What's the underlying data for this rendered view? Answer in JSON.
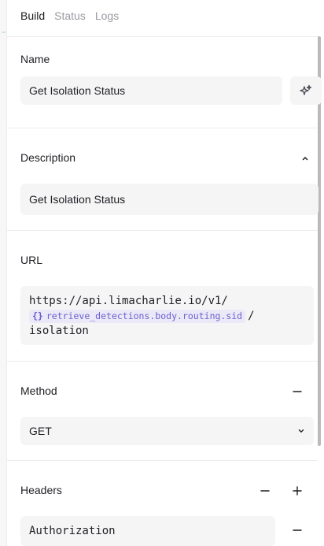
{
  "tabs": [
    "Build",
    "Status",
    "Logs"
  ],
  "name": {
    "label": "Name",
    "value": "Get Isolation Status",
    "ai_icon": "sparkles-icon"
  },
  "description": {
    "label": "Description",
    "value": "Get Isolation Status",
    "toggle_icon": "chevron-up-icon"
  },
  "url": {
    "label": "URL",
    "prefix": "https://api.limacharlie.io/v1/",
    "variable_brace": "{}",
    "variable": "retrieve_detections.body.routing.sid",
    "separator": "/",
    "suffix": "isolation"
  },
  "method": {
    "label": "Method",
    "value": "GET",
    "collapse_icon": "minus-icon",
    "dropdown_icon": "chevron-down-icon"
  },
  "headers": {
    "label": "Headers",
    "remove_icon": "minus-icon",
    "add_icon": "plus-icon",
    "items": [
      {
        "key": "Authorization",
        "remove_icon": "minus-icon"
      }
    ]
  }
}
